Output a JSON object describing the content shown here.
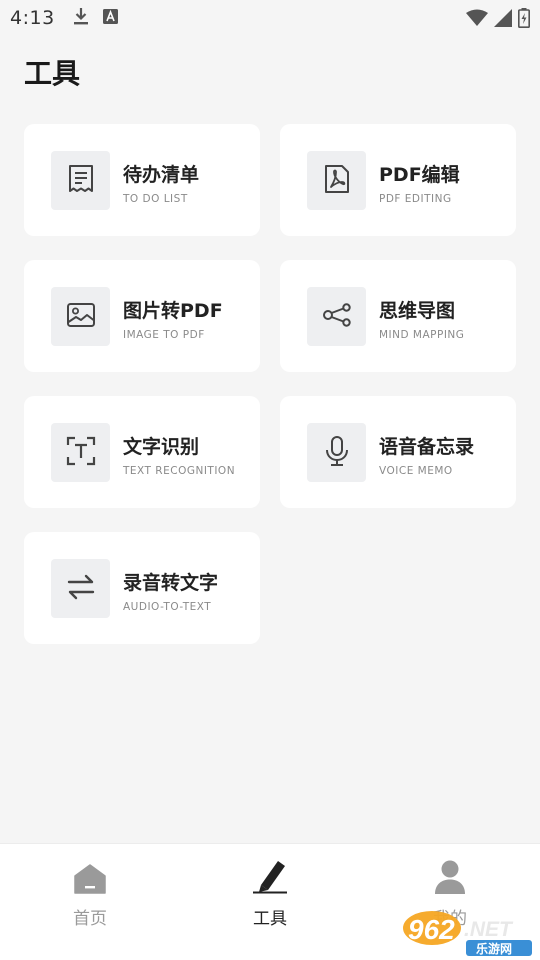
{
  "status_bar": {
    "time": "4:13",
    "icons": [
      "download-icon",
      "text-a-icon",
      "wifi-icon",
      "signal-icon",
      "battery-icon"
    ]
  },
  "page": {
    "title": "工具"
  },
  "tools": [
    {
      "title": "待办清单",
      "subtitle": "TO DO LIST",
      "icon": "receipt-list-icon"
    },
    {
      "title": "PDF编辑",
      "subtitle": "PDF EDITING",
      "icon": "pdf-icon"
    },
    {
      "title": "图片转PDF",
      "subtitle": "IMAGE TO PDF",
      "icon": "image-icon"
    },
    {
      "title": "思维导图",
      "subtitle": "MIND MAPPING",
      "icon": "mind-map-icon"
    },
    {
      "title": "文字识别",
      "subtitle": "TEXT RECOGNITION",
      "icon": "text-scan-icon"
    },
    {
      "title": "语音备忘录",
      "subtitle": "VOICE MEMO",
      "icon": "microphone-icon"
    },
    {
      "title": "录音转文字",
      "subtitle": "AUDIO-TO-TEXT",
      "icon": "swap-arrows-icon"
    }
  ],
  "bottom_nav": {
    "items": [
      {
        "label": "首页",
        "icon": "home-icon",
        "active": false
      },
      {
        "label": "工具",
        "icon": "pen-icon",
        "active": true
      },
      {
        "label": "我的",
        "icon": "person-icon",
        "active": false
      }
    ]
  },
  "watermark": {
    "text_number": "962",
    "text_suffix": ".NET",
    "text_cn": "乐游网"
  },
  "colors": {
    "background": "#f5f5f5",
    "card": "#ffffff",
    "icon_box": "#eeeff1",
    "text_primary": "#222222",
    "text_secondary": "#8a8a8a",
    "nav_inactive": "#9a9a9a"
  }
}
